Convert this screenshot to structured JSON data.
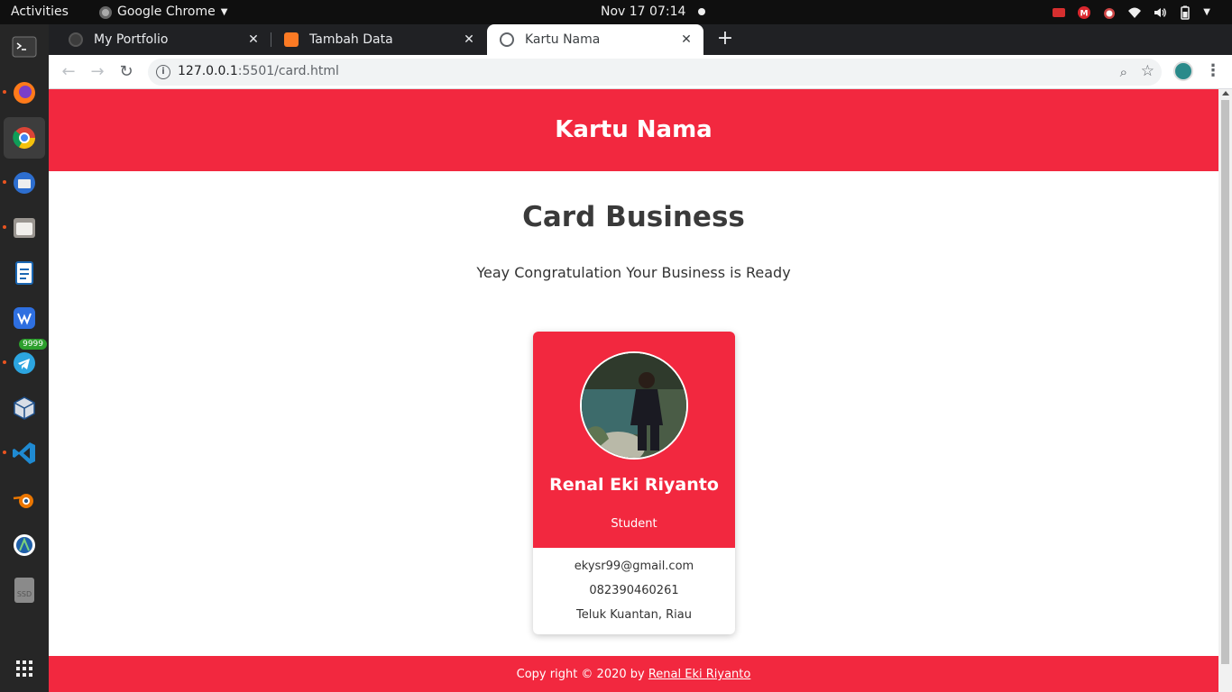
{
  "topbar": {
    "activities": "Activities",
    "app_name": "Google Chrome",
    "clock": "Nov 17  07:14"
  },
  "dock": {
    "items": [
      "terminal-icon",
      "firefox-icon",
      "chrome-icon",
      "thunderbird-icon",
      "files-icon",
      "writer-icon",
      "wps-icon",
      "telegram-icon",
      "virtualbox-icon",
      "vscode-icon",
      "blender-icon",
      "android-studio-icon",
      "ssd-drive-icon",
      "app-grid-icon"
    ],
    "telegram_badge": "9999",
    "ssd_label": "SSD"
  },
  "tabs": [
    {
      "label": "My Portfolio",
      "icon": "globe-icon",
      "active": false
    },
    {
      "label": "Tambah Data",
      "icon": "xampp-icon",
      "active": false
    },
    {
      "label": "Kartu Nama",
      "icon": "globe-icon",
      "active": true
    }
  ],
  "omnibox": {
    "host": "127.0.0.1",
    "path": ":5501/card.html"
  },
  "page": {
    "header_title": "Kartu Nama",
    "title": "Card Business",
    "subtitle": "Yeay Congratulation Your Business is Ready",
    "card": {
      "name": "Renal Eki Riyanto",
      "role": "Student",
      "email": "ekysr99@gmail.com",
      "phone": "082390460261",
      "address": "Teluk Kuantan, Riau"
    },
    "footer_text": "Copy right © 2020 by ",
    "footer_link": "Renal Eki Riyanto"
  },
  "colors": {
    "brand_red": "#f2283f",
    "title_text": "#3a3a3a"
  }
}
